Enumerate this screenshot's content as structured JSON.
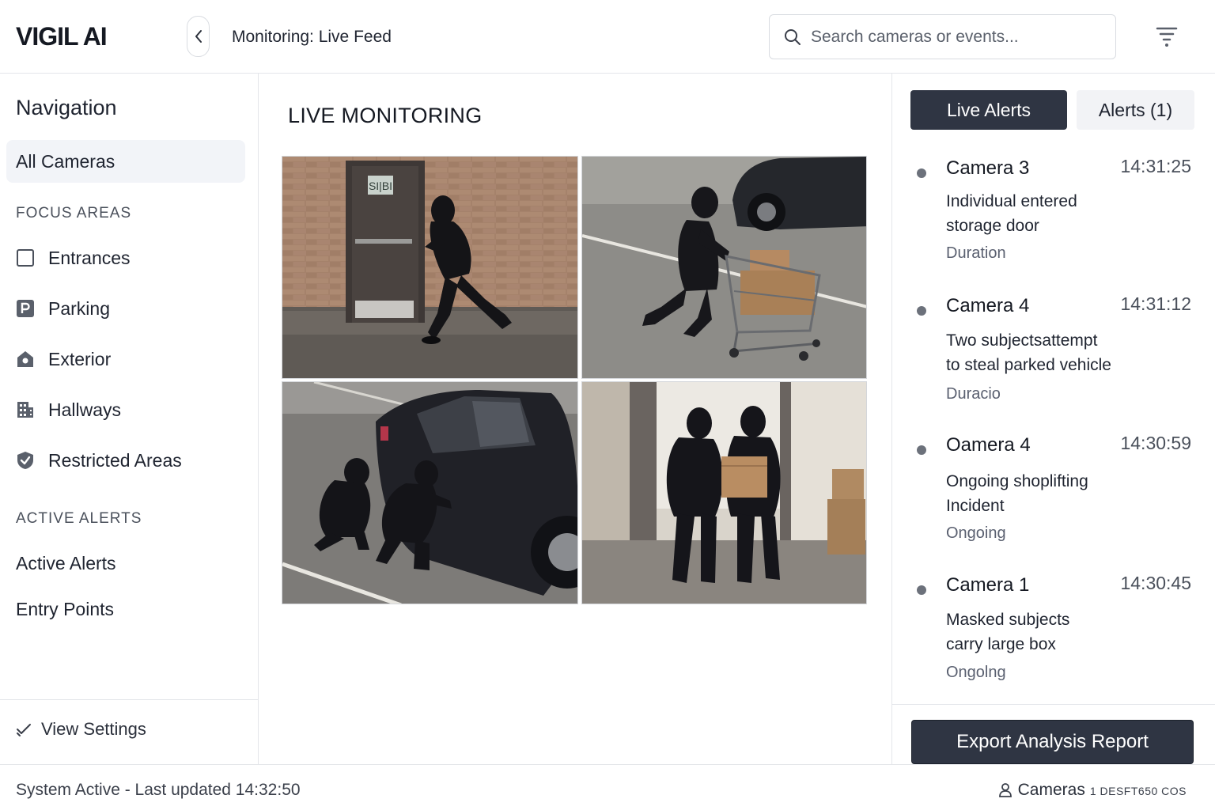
{
  "app": {
    "brand": "VIGIL AI",
    "page_title": "Monitoring: Live Feed"
  },
  "search": {
    "placeholder": "Search cameras or events..."
  },
  "sidebar": {
    "title": "Navigation",
    "all_cameras": "All Cameras",
    "focus_label": "FOCUS AREAS",
    "focus_items": [
      {
        "label": "Entrances",
        "icon": "square-icon"
      },
      {
        "label": "Parking",
        "icon": "parking-icon"
      },
      {
        "label": "Exterior",
        "icon": "house-icon"
      },
      {
        "label": "Hallways",
        "icon": "building-icon"
      },
      {
        "label": "Restricted Areas",
        "icon": "shield-check-icon"
      }
    ],
    "alerts_label": "ACTIVE ALERTS",
    "alert_items": [
      "Active Alerts",
      "Entry Points"
    ],
    "view_settings": "View Settings"
  },
  "main": {
    "title": "LIVE MONITORING",
    "door_sign": "SI|BI"
  },
  "right_panel": {
    "tabs": {
      "live": "Live Alerts",
      "alerts": "Alerts (1)"
    },
    "alerts": [
      {
        "camera": "Camera 3",
        "time": "14:31:25",
        "line1": "Individual entered",
        "line2": "storage door",
        "status": "Duration"
      },
      {
        "camera": "Camera 4",
        "time": "14:31:12",
        "line1": "Two subjectsattempt",
        "line2": "to steal parked vehicle",
        "status": "Duracio"
      },
      {
        "camera": "Oamera 4",
        "time": "14:30:59",
        "line1": "Ongoing shoplifting",
        "line2": "Incident",
        "status": "Ongoing"
      },
      {
        "camera": "Camera 1",
        "time": "14:30:45",
        "line1": "Masked subjects",
        "line2": "carry large box",
        "status": "Ongolng"
      }
    ],
    "export_label": "Export Analysis Report"
  },
  "footer": {
    "status": "System Active - Last updated 14:32:50",
    "cameras_label": "Cameras",
    "cameras_code": "1 DESFT650 COS"
  },
  "colors": {
    "accent_dark": "#2f3543",
    "sidebar_active_bg": "#f2f4f8",
    "border": "#e4e6ea"
  }
}
